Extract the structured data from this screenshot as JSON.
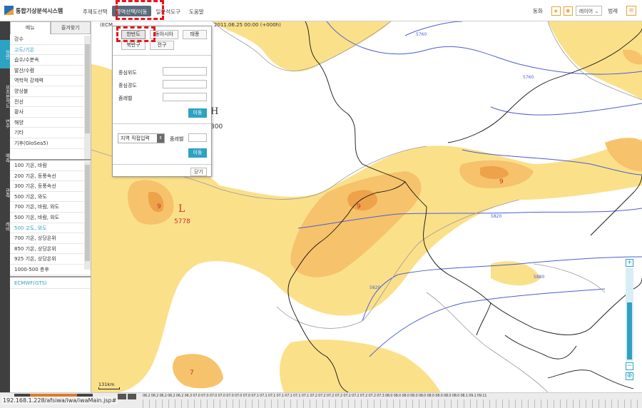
{
  "app": {
    "title": "통합기상분석시스템",
    "top_menu": [
      "주제도선택",
      "영역선택/이동",
      "일분석도구",
      "도움말"
    ],
    "top_menu_active_index": 1,
    "right": {
      "animate_label": "동화",
      "layer_label": "레이어",
      "legend_label": "범례"
    }
  },
  "sidebar_strip": [
    "일반",
    "보조분석도",
    "변수",
    "예측",
    "관측",
    "레비"
  ],
  "left_panel": {
    "tabs": [
      "메뉴",
      "즐겨찾기"
    ],
    "group1": [
      "강수",
      "고도/기온",
      "습수/수분속",
      "발산/수렴",
      "역학적 강제력",
      "양상블",
      "전선",
      "황사",
      "해양",
      "기타",
      "기후(GloSea5)"
    ],
    "group1_selected": "고도/기온",
    "group2": [
      "100 기온, 바람",
      "200 기온, 등풍속선",
      "300 기온, 등풍속선",
      "500 기온, 와도",
      "700 기온, 바람, 와도",
      "500 기온, 바람, 와도",
      "500 고도, 와도",
      "700 기온, 상당온위",
      "850 기온, 상당온위",
      "925 기온, 상당온위",
      "1000-500 층후"
    ],
    "group2_selected": "500 고도, 와도",
    "group3": [
      "ECMWF(GTS)"
    ]
  },
  "map": {
    "header": "(ECM",
    "header_time": "2011.06.25 00:00 (+000h)",
    "scale_label": "131km",
    "high_label": "H",
    "high_value": "300",
    "low_label": "L",
    "low_value": "5778",
    "contours": [
      "5760",
      "5760",
      "5820",
      "5880",
      "5820"
    ],
    "vort_labels": [
      "9",
      "9",
      "9",
      "7"
    ]
  },
  "popup": {
    "region_buttons": [
      "한반도",
      "동아시아",
      "태풍",
      "북반구",
      "전구"
    ],
    "region_active": "한반도",
    "center_lat_label": "중심위도",
    "center_lon_label": "중심경도",
    "zoom_label": "줌레벨",
    "go_label": "이동",
    "region_input_label": "지역 직접입력",
    "zoom_label2": "줌레벨",
    "go_label2": "이동",
    "close_label": "닫기"
  },
  "statusbar": {
    "url": "192.168.1.228/afsiwa/iwa/iwaMain.jsp#",
    "timeline": "06.2 06.2 06.2 06.2 06.2 06.3 07.0 07.0 07.0 07.0 07.0 07.0 07.0 07.1 07.1 07.1 07.1 07.1 07.1 07.1 07.2 07.2 07.2 07.2 07.2 07.2 07.2 07.2 07.3 08.0 08.0 08.0 08.0 08.0 08.0 08.0 08.0 08.0 08.1 09.1 09.11"
  }
}
